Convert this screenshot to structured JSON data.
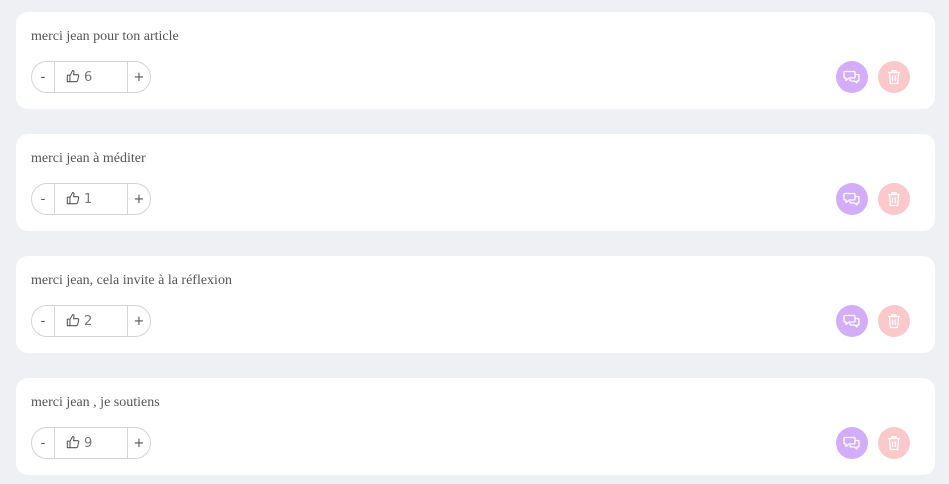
{
  "comments": [
    {
      "text": "merci jean pour ton article",
      "likes": "6"
    },
    {
      "text": "merci jean à méditer",
      "likes": "1"
    },
    {
      "text": "merci jean, cela invite à la réflexion",
      "likes": "2"
    },
    {
      "text": "merci jean , je soutiens",
      "likes": "9"
    }
  ],
  "controls": {
    "decrement_label": "-",
    "increment_label": "+",
    "like_icon": "thumbs-up-icon",
    "reply_icon": "chat-bubbles-icon",
    "delete_icon": "trash-icon"
  },
  "colors": {
    "page_background": "#eff0f4",
    "card_background": "#ffffff",
    "reply_button": "#d3adf9",
    "delete_button": "#fbc9cb"
  }
}
